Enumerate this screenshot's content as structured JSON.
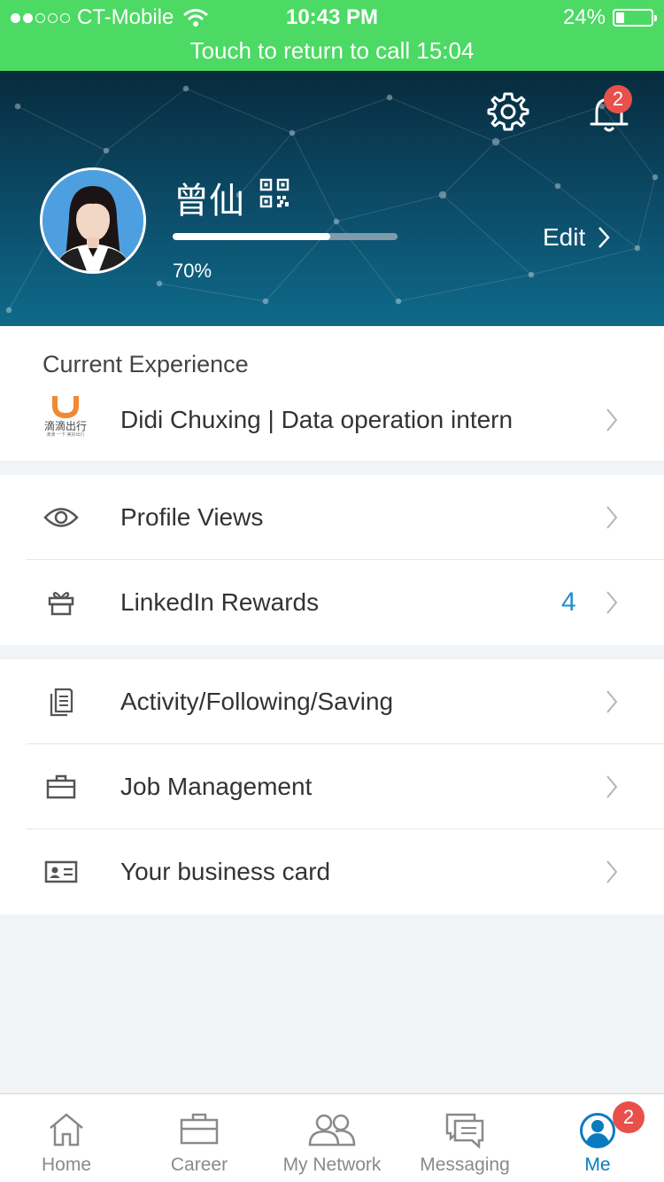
{
  "status_bar": {
    "carrier": "CT-Mobile",
    "time": "10:43 PM",
    "battery": "24%",
    "battery_level": 0.24,
    "call_banner": "Touch to return to call 15:04"
  },
  "header": {
    "notifications_badge": "2",
    "name": "曾仙",
    "profile_completion_pct": "70%",
    "profile_completion": 0.7,
    "edit_label": "Edit"
  },
  "current_experience": {
    "title": "Current Experience",
    "logo_text": "滴滴出行",
    "logo_subtext": "滴滴 一下 美好出行",
    "entry": "Didi Chuxing | Data operation intern"
  },
  "menu1": {
    "items": [
      {
        "label": "Profile Views",
        "icon": "eye-icon"
      },
      {
        "label": "LinkedIn Rewards",
        "icon": "gift-icon",
        "count": "4"
      }
    ]
  },
  "menu2": {
    "items": [
      {
        "label": "Activity/Following/Saving",
        "icon": "document-icon"
      },
      {
        "label": "Job Management",
        "icon": "briefcase-icon"
      },
      {
        "label": "Your business card",
        "icon": "id-card-icon"
      }
    ]
  },
  "tabbar": {
    "tabs": [
      {
        "label": "Home",
        "icon": "home-icon"
      },
      {
        "label": "Career",
        "icon": "briefcase-icon"
      },
      {
        "label": "My Network",
        "icon": "people-icon"
      },
      {
        "label": "Messaging",
        "icon": "chat-icon"
      },
      {
        "label": "Me",
        "icon": "person-icon",
        "badge": "2",
        "active": true
      }
    ]
  },
  "colors": {
    "status_green": "#4cd964",
    "accent_blue": "#0a7bc1",
    "badge_red": "#e9504b",
    "didi_orange": "#f08a32"
  }
}
